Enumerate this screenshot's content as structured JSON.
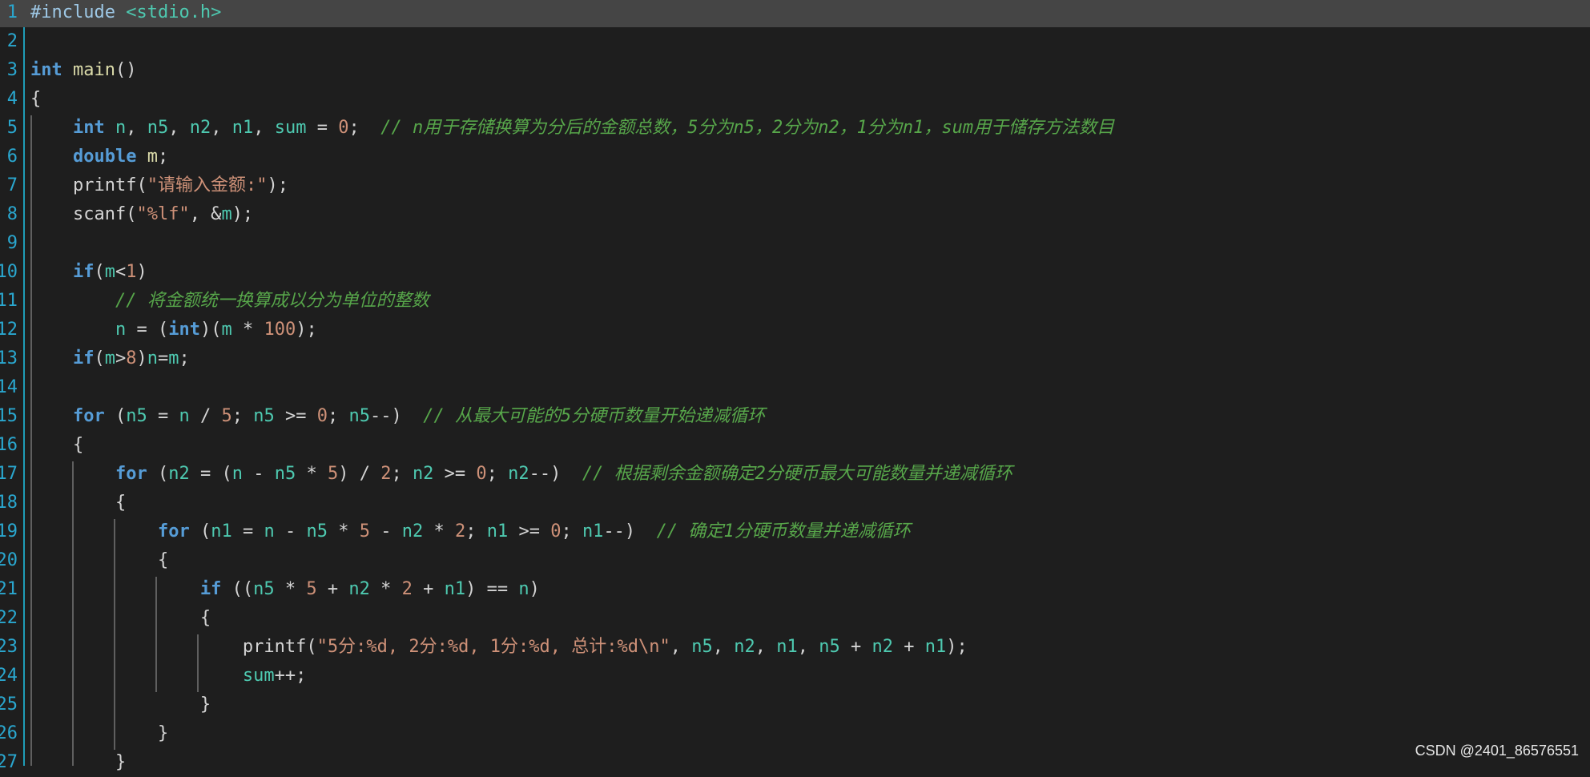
{
  "editor": {
    "language": "c",
    "active_line": 1,
    "lines": [
      [
        [
          "#include ",
          "pp"
        ],
        [
          "<stdio.h>",
          "hd"
        ]
      ],
      [],
      [
        [
          "int",
          "kw"
        ],
        [
          " ",
          "pl"
        ],
        [
          "main",
          "fn"
        ],
        [
          "()",
          "pl"
        ]
      ],
      [
        [
          "{",
          "pl"
        ]
      ],
      [
        [
          "    ",
          "pl"
        ],
        [
          "int",
          "kw"
        ],
        [
          " ",
          "pl"
        ],
        [
          "n",
          "id"
        ],
        [
          ", ",
          "pl"
        ],
        [
          "n5",
          "id"
        ],
        [
          ", ",
          "pl"
        ],
        [
          "n2",
          "id"
        ],
        [
          ", ",
          "pl"
        ],
        [
          "n1",
          "id"
        ],
        [
          ", ",
          "pl"
        ],
        [
          "sum",
          "id"
        ],
        [
          " = ",
          "pl"
        ],
        [
          "0",
          "num"
        ],
        [
          ";  ",
          "pl"
        ],
        [
          "// n用于存储换算为分后的金额总数，5分为n5，2分为n2，1分为n1，sum用于储存方法数目",
          "cm"
        ]
      ],
      [
        [
          "    ",
          "pl"
        ],
        [
          "double",
          "kw"
        ],
        [
          " ",
          "pl"
        ],
        [
          "m",
          "fn"
        ],
        [
          ";",
          "pl"
        ]
      ],
      [
        [
          "    printf(",
          "pl"
        ],
        [
          "\"请输入金额:\"",
          "str"
        ],
        [
          ");",
          "pl"
        ]
      ],
      [
        [
          "    scanf(",
          "pl"
        ],
        [
          "\"%lf\"",
          "str"
        ],
        [
          ", &",
          "pl"
        ],
        [
          "m",
          "id"
        ],
        [
          ");",
          "pl"
        ]
      ],
      [],
      [
        [
          "    ",
          "pl"
        ],
        [
          "if",
          "kw"
        ],
        [
          "(",
          "pl"
        ],
        [
          "m",
          "id"
        ],
        [
          "<",
          "pl"
        ],
        [
          "1",
          "num"
        ],
        [
          ")",
          "pl"
        ]
      ],
      [
        [
          "        ",
          "pl"
        ],
        [
          "// 将金额统一换算成以分为单位的整数",
          "cm"
        ]
      ],
      [
        [
          "        ",
          "pl"
        ],
        [
          "n",
          "id"
        ],
        [
          " = (",
          "pl"
        ],
        [
          "int",
          "kw"
        ],
        [
          ")(",
          "pl"
        ],
        [
          "m",
          "id"
        ],
        [
          " * ",
          "pl"
        ],
        [
          "100",
          "num"
        ],
        [
          ");",
          "pl"
        ]
      ],
      [
        [
          "    ",
          "pl"
        ],
        [
          "if",
          "kw"
        ],
        [
          "(",
          "pl"
        ],
        [
          "m",
          "id"
        ],
        [
          ">",
          "pl"
        ],
        [
          "8",
          "num"
        ],
        [
          ")",
          "pl"
        ],
        [
          "n",
          "id"
        ],
        [
          "=",
          "pl"
        ],
        [
          "m",
          "id"
        ],
        [
          ";",
          "pl"
        ]
      ],
      [],
      [
        [
          "    ",
          "pl"
        ],
        [
          "for",
          "kw"
        ],
        [
          " (",
          "pl"
        ],
        [
          "n5",
          "id"
        ],
        [
          " = ",
          "pl"
        ],
        [
          "n",
          "id"
        ],
        [
          " / ",
          "pl"
        ],
        [
          "5",
          "num"
        ],
        [
          "; ",
          "pl"
        ],
        [
          "n5",
          "id"
        ],
        [
          " >= ",
          "pl"
        ],
        [
          "0",
          "num"
        ],
        [
          "; ",
          "pl"
        ],
        [
          "n5",
          "id"
        ],
        [
          "--)  ",
          "pl"
        ],
        [
          "// 从最大可能的5分硬币数量开始递减循环",
          "cm"
        ]
      ],
      [
        [
          "    {",
          "pl"
        ]
      ],
      [
        [
          "        ",
          "pl"
        ],
        [
          "for",
          "kw"
        ],
        [
          " (",
          "pl"
        ],
        [
          "n2",
          "id"
        ],
        [
          " = (",
          "pl"
        ],
        [
          "n",
          "id"
        ],
        [
          " - ",
          "pl"
        ],
        [
          "n5",
          "id"
        ],
        [
          " * ",
          "pl"
        ],
        [
          "5",
          "num"
        ],
        [
          ") / ",
          "pl"
        ],
        [
          "2",
          "num"
        ],
        [
          "; ",
          "pl"
        ],
        [
          "n2",
          "id"
        ],
        [
          " >= ",
          "pl"
        ],
        [
          "0",
          "num"
        ],
        [
          "; ",
          "pl"
        ],
        [
          "n2",
          "id"
        ],
        [
          "--)  ",
          "pl"
        ],
        [
          "// 根据剩余金额确定2分硬币最大可能数量并递减循环",
          "cm"
        ]
      ],
      [
        [
          "        {",
          "pl"
        ]
      ],
      [
        [
          "            ",
          "pl"
        ],
        [
          "for",
          "kw"
        ],
        [
          " (",
          "pl"
        ],
        [
          "n1",
          "id"
        ],
        [
          " = ",
          "pl"
        ],
        [
          "n",
          "id"
        ],
        [
          " - ",
          "pl"
        ],
        [
          "n5",
          "id"
        ],
        [
          " * ",
          "pl"
        ],
        [
          "5",
          "num"
        ],
        [
          " - ",
          "pl"
        ],
        [
          "n2",
          "id"
        ],
        [
          " * ",
          "pl"
        ],
        [
          "2",
          "num"
        ],
        [
          "; ",
          "pl"
        ],
        [
          "n1",
          "id"
        ],
        [
          " >= ",
          "pl"
        ],
        [
          "0",
          "num"
        ],
        [
          "; ",
          "pl"
        ],
        [
          "n1",
          "id"
        ],
        [
          "--)  ",
          "pl"
        ],
        [
          "// 确定1分硬币数量并递减循环",
          "cm"
        ]
      ],
      [
        [
          "            {",
          "pl"
        ]
      ],
      [
        [
          "                ",
          "pl"
        ],
        [
          "if",
          "kw"
        ],
        [
          " ((",
          "pl"
        ],
        [
          "n5",
          "id"
        ],
        [
          " * ",
          "pl"
        ],
        [
          "5",
          "num"
        ],
        [
          " + ",
          "pl"
        ],
        [
          "n2",
          "id"
        ],
        [
          " * ",
          "pl"
        ],
        [
          "2",
          "num"
        ],
        [
          " + ",
          "pl"
        ],
        [
          "n1",
          "id"
        ],
        [
          ") == ",
          "pl"
        ],
        [
          "n",
          "id"
        ],
        [
          ")",
          "pl"
        ]
      ],
      [
        [
          "                {",
          "pl"
        ]
      ],
      [
        [
          "                    printf(",
          "pl"
        ],
        [
          "\"5分:%d, 2分:%d, 1分:%d, 总计:%d\\n\"",
          "str"
        ],
        [
          ", ",
          "pl"
        ],
        [
          "n5",
          "id"
        ],
        [
          ", ",
          "pl"
        ],
        [
          "n2",
          "id"
        ],
        [
          ", ",
          "pl"
        ],
        [
          "n1",
          "id"
        ],
        [
          ", ",
          "pl"
        ],
        [
          "n5",
          "id"
        ],
        [
          " + ",
          "pl"
        ],
        [
          "n2",
          "id"
        ],
        [
          " + ",
          "pl"
        ],
        [
          "n1",
          "id"
        ],
        [
          ");",
          "pl"
        ]
      ],
      [
        [
          "                    ",
          "pl"
        ],
        [
          "sum",
          "id"
        ],
        [
          "++;",
          "pl"
        ]
      ],
      [
        [
          "                }",
          "pl"
        ]
      ],
      [
        [
          "            }",
          "pl"
        ]
      ],
      [
        [
          "        }",
          "pl"
        ]
      ]
    ]
  },
  "watermark": "CSDN @2401_86576551"
}
